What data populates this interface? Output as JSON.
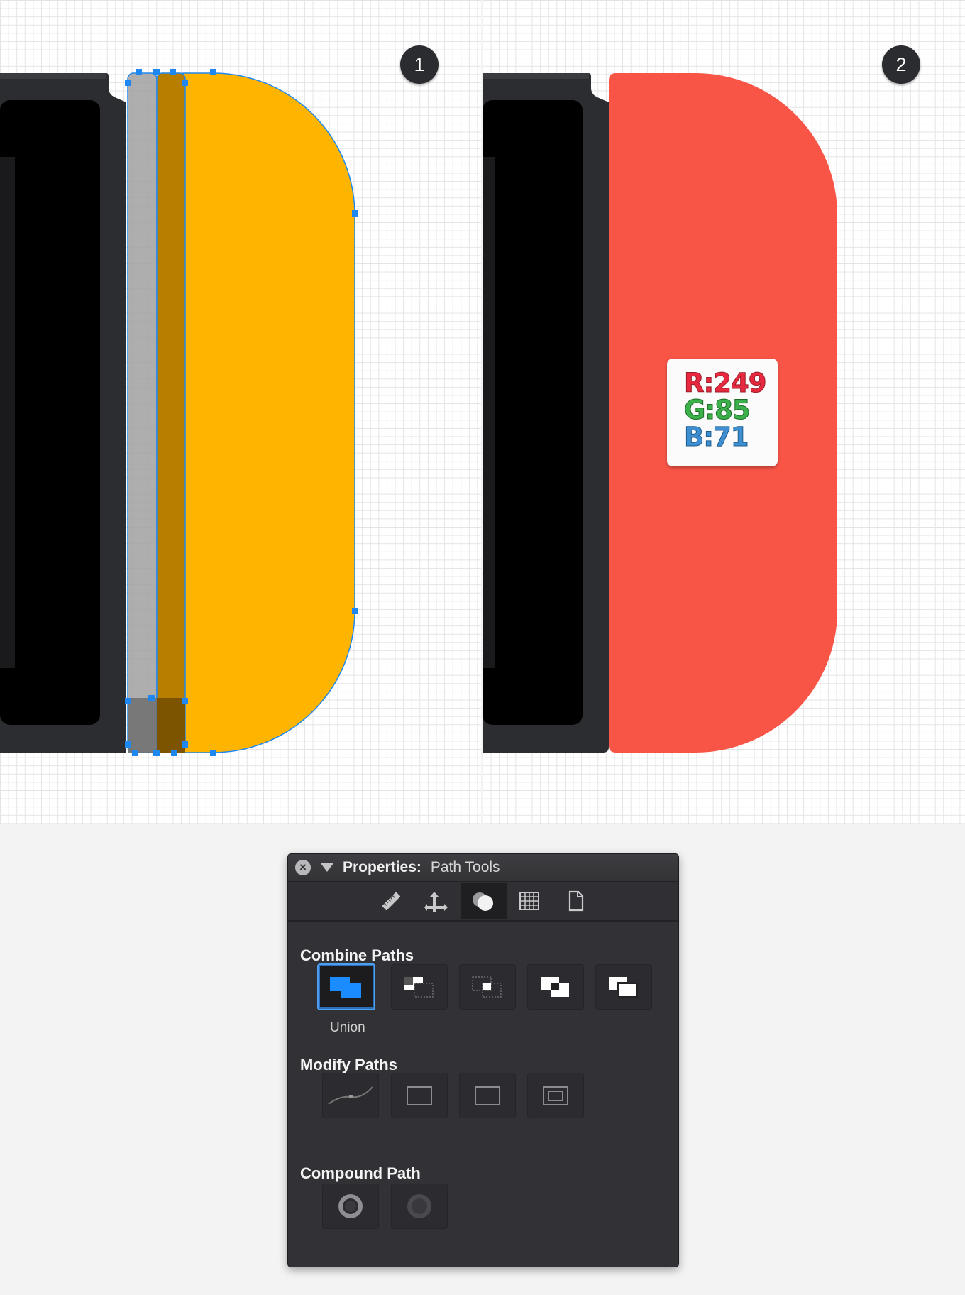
{
  "step_badges": {
    "one": "1",
    "two": "2"
  },
  "colors": {
    "device_dark": "#2c2d30",
    "screen": "#000000",
    "shape_yellow": "#ffb400",
    "shape_red": "#f95547",
    "selection_blue": "#1e88f0",
    "panel_bg": "#323236"
  },
  "color_card": {
    "r_label": "R:249",
    "g_label": "G:85",
    "b_label": "B:71"
  },
  "properties_panel": {
    "title_label": "Properties:",
    "title_value": "Path Tools",
    "tabs": [
      "ruler-icon",
      "align-arrows-icon",
      "path-combine-icon",
      "grid-icon",
      "document-icon"
    ],
    "combine_title": "Combine Paths",
    "combine_selected_label": "Union",
    "combine_ops": [
      "union-icon",
      "subtract-icon",
      "intersect-icon",
      "exclude-icon",
      "divide-icon"
    ],
    "modify_title": "Modify Paths",
    "modify_ops": [
      "simplify-path-icon",
      "outline-stroke-icon",
      "expand-icon",
      "offset-path-icon"
    ],
    "compound_title": "Compound Path",
    "compound_ops": [
      "make-compound-icon",
      "release-compound-icon"
    ]
  }
}
